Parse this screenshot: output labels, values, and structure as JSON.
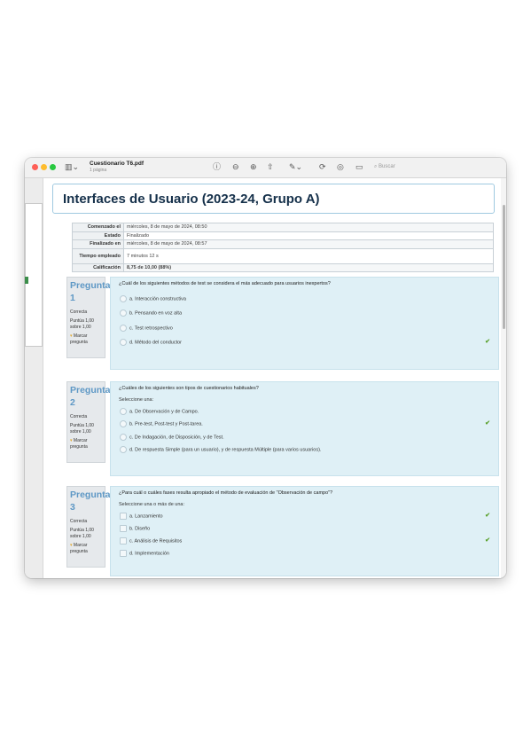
{
  "toolbar": {
    "title": "Cuestionario T6.pdf",
    "subtitle": "1 página",
    "sidebar_toggle_icon": "sidebar-icon",
    "info_icon": "info-icon",
    "zoom_out_icon": "zoom-out-icon",
    "zoom_in_icon": "zoom-in-icon",
    "share_icon": "share-icon",
    "markup_icon": "pen-icon",
    "rotate_icon": "rotate-icon",
    "annotate_icon": "markup-circle-icon",
    "form_icon": "form-icon",
    "search_placeholder": "Buscar"
  },
  "document": {
    "course_title": "Interfaces de Usuario (2023-24, Grupo A)",
    "summary": [
      {
        "key": "Comenzado el",
        "value": "miércoles, 8 de mayo de 2024, 08:50"
      },
      {
        "key": "Estado",
        "value": "Finalizado"
      },
      {
        "key": "Finalizado en",
        "value": "miércoles, 8 de mayo de 2024, 08:57"
      },
      {
        "key": "Tiempo empleado",
        "value": "7 minutos 12 s"
      },
      {
        "key": "Calificación",
        "value": "8,75 de 10,00 (88%)"
      }
    ],
    "questions": [
      {
        "label": "Pregunta",
        "number": "1",
        "state": "Correcta",
        "mark": "Puntúa 1,00 sobre 1,00",
        "flag": "Marcar pregunta",
        "text": "¿Cuál de los siguientes métodos de test se considera el más adecuado para usuarios inexpertos?",
        "prompt": "",
        "options": [
          {
            "text": "a. Interacción constructiva",
            "correct": false
          },
          {
            "text": "b. Pensando en voz alta",
            "correct": false
          },
          {
            "text": "c. Test retrospectivo",
            "correct": false
          },
          {
            "text": "d. Método del conductor",
            "correct": true
          }
        ]
      },
      {
        "label": "Pregunta",
        "number": "2",
        "state": "Correcta",
        "mark": "Puntúa 1,00 sobre 1,00",
        "flag": "Marcar pregunta",
        "text": "¿Cuáles de los siguientes son tipos de cuestionarios habituales?",
        "prompt": "Seleccione una:",
        "options": [
          {
            "text": "a. De Observación y de Campo.",
            "correct": false
          },
          {
            "text": "b. Pre-test, Post-test y Post-tarea.",
            "correct": true
          },
          {
            "text": "c. De Indagación, de Disposición, y de Test.",
            "correct": false
          },
          {
            "text": "d. De respuesta Simple (para un usuario), y de respuesta Múltiple (para varios usuarios).",
            "correct": false
          }
        ]
      },
      {
        "label": "Pregunta",
        "number": "3",
        "state": "Correcta",
        "mark": "Puntúa 1,00 sobre 1,00",
        "flag": "Marcar pregunta",
        "text": "¿Para cuál o cuáles fases resulta apropiado el método de evaluación de \"Observación de campo\"?",
        "prompt": "Seleccione una o más de una:",
        "options": [
          {
            "text": "a. Lanzamiento",
            "correct": true
          },
          {
            "text": "b. Diseño",
            "correct": false
          },
          {
            "text": "c. Análisis de Requisitos",
            "correct": true
          },
          {
            "text": "d. Implementación",
            "correct": false
          }
        ]
      }
    ]
  }
}
